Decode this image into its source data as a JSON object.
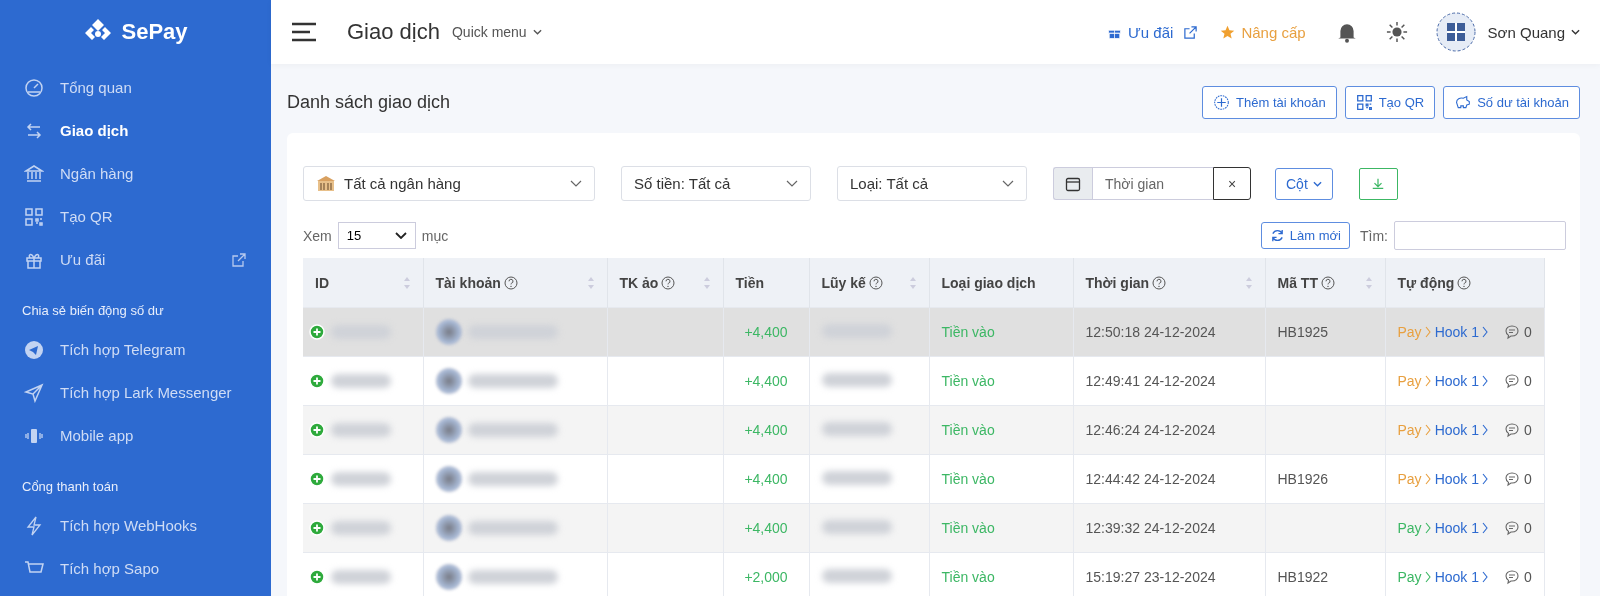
{
  "sidebar": {
    "logo": "SePay",
    "sections": [
      {
        "items": [
          {
            "label": "Tổng quan",
            "selected": false,
            "external": false
          },
          {
            "label": "Giao dịch",
            "selected": true,
            "external": false
          },
          {
            "label": "Ngân hàng",
            "selected": false,
            "external": false
          },
          {
            "label": "Tạo QR",
            "selected": false,
            "external": false
          },
          {
            "label": "Ưu đãi",
            "selected": false,
            "external": true
          }
        ]
      },
      {
        "heading": "Chia sẻ biến động số dư",
        "items": [
          {
            "label": "Tích hợp Telegram",
            "selected": false,
            "external": false
          },
          {
            "label": "Tích hợp Lark Messenger",
            "selected": false,
            "external": false
          },
          {
            "label": "Mobile app",
            "selected": false,
            "external": false
          }
        ]
      },
      {
        "heading": "Cổng thanh toán",
        "items": [
          {
            "label": "Tích hợp WebHooks",
            "selected": false,
            "external": false
          },
          {
            "label": "Tích hợp Sapo",
            "selected": false,
            "external": false
          }
        ]
      }
    ]
  },
  "header": {
    "title": "Giao dịch",
    "quick_menu": "Quick menu",
    "offer": "Ưu đãi",
    "upgrade": "Nâng cấp",
    "user": "Sơn Quang"
  },
  "page": {
    "title": "Danh sách giao dịch",
    "actions": [
      {
        "label": "Thêm tài khoản"
      },
      {
        "label": "Tạo QR"
      },
      {
        "label": "Số dư tài khoản"
      }
    ]
  },
  "filters": {
    "bank": "Tất cả ngân hàng",
    "amount": "Số tiền: Tất cả",
    "type": "Loại: Tất cả",
    "date": {
      "placeholder": "Thời gian"
    },
    "clear": "×",
    "columns": "Cột"
  },
  "length": {
    "prefix": "Xem",
    "value": "15",
    "suffix": "mục"
  },
  "refresh": "Làm mới",
  "search": {
    "label": "Tìm:"
  },
  "table": {
    "columns": [
      {
        "label": "ID",
        "help": false,
        "sortable": true
      },
      {
        "label": "Tài khoản",
        "help": true,
        "sortable": true
      },
      {
        "label": "TK ảo",
        "help": true,
        "sortable": true
      },
      {
        "label": "Tiền",
        "help": false,
        "sortable": false
      },
      {
        "label": "Lũy kế",
        "help": true,
        "sortable": true
      },
      {
        "label": "Loại giao dịch",
        "help": false,
        "sortable": false
      },
      {
        "label": "Thời gian",
        "help": true,
        "sortable": true
      },
      {
        "label": "Mã TT",
        "help": true,
        "sortable": true
      },
      {
        "label": "Tự động",
        "help": true,
        "sortable": false
      }
    ],
    "rows": [
      {
        "selected": true,
        "amount": "+4,400",
        "type": "Tiền vào",
        "time": "12:50:18 24-12-2024",
        "code": "HB1925",
        "pay": "Pay",
        "color": "#e8a040",
        "hook": "Hook 1",
        "comments": "0"
      },
      {
        "selected": false,
        "amount": "+4,400",
        "type": "Tiền vào",
        "time": "12:49:41 24-12-2024",
        "pay": "Pay",
        "color": "#e8a040",
        "hook": "Hook 1",
        "comments": "0"
      },
      {
        "selected": false,
        "amount": "+4,400",
        "type": "Tiền vào",
        "time": "12:46:24 24-12-2024",
        "pay": "Pay",
        "color": "#e8a040",
        "hook": "Hook 1",
        "comments": "0"
      },
      {
        "selected": false,
        "amount": "+4,400",
        "type": "Tiền vào",
        "time": "12:44:42 24-12-2024",
        "code": "HB1926",
        "pay": "Pay",
        "color": "#e8a040",
        "hook": "Hook 1",
        "comments": "0"
      },
      {
        "selected": false,
        "amount": "+4,400",
        "type": "Tiền vào",
        "time": "12:39:32 24-12-2024",
        "pay": "Pay",
        "color": "#3cb764",
        "hook": "Hook 1",
        "comments": "0"
      },
      {
        "selected": false,
        "amount": "+2,000",
        "type": "Tiền vào",
        "time": "15:19:27 23-12-2024",
        "code": "HB1922",
        "pay": "Pay",
        "color": "#3cb764",
        "hook": "Hook 1",
        "comments": "0"
      }
    ]
  }
}
